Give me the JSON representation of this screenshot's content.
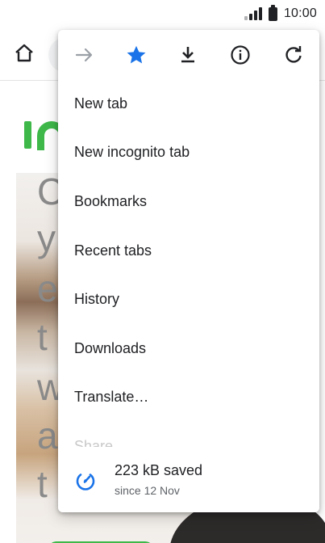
{
  "status_bar": {
    "time": "10:00"
  },
  "menu": {
    "toolbar_icons": [
      "forward-icon",
      "bookmark-star-icon",
      "download-icon",
      "info-icon",
      "refresh-icon"
    ],
    "items": [
      {
        "label": "New tab"
      },
      {
        "label": "New incognito tab"
      },
      {
        "label": "Bookmarks"
      },
      {
        "label": "Recent tabs"
      },
      {
        "label": "History"
      },
      {
        "label": "Downloads"
      },
      {
        "label": "Translate…"
      }
    ],
    "partial_item": "Share...",
    "data_saver": {
      "title": "223 kB saved",
      "subtitle": "since 12 Nov"
    }
  },
  "page": {
    "hero_letters": [
      "C",
      "y",
      "e",
      "t",
      "w",
      "a",
      "t"
    ]
  },
  "colors": {
    "accent_blue": "#1a73e8",
    "brand_green": "#3fb84a",
    "disabled_grey": "#9aa0a6"
  }
}
